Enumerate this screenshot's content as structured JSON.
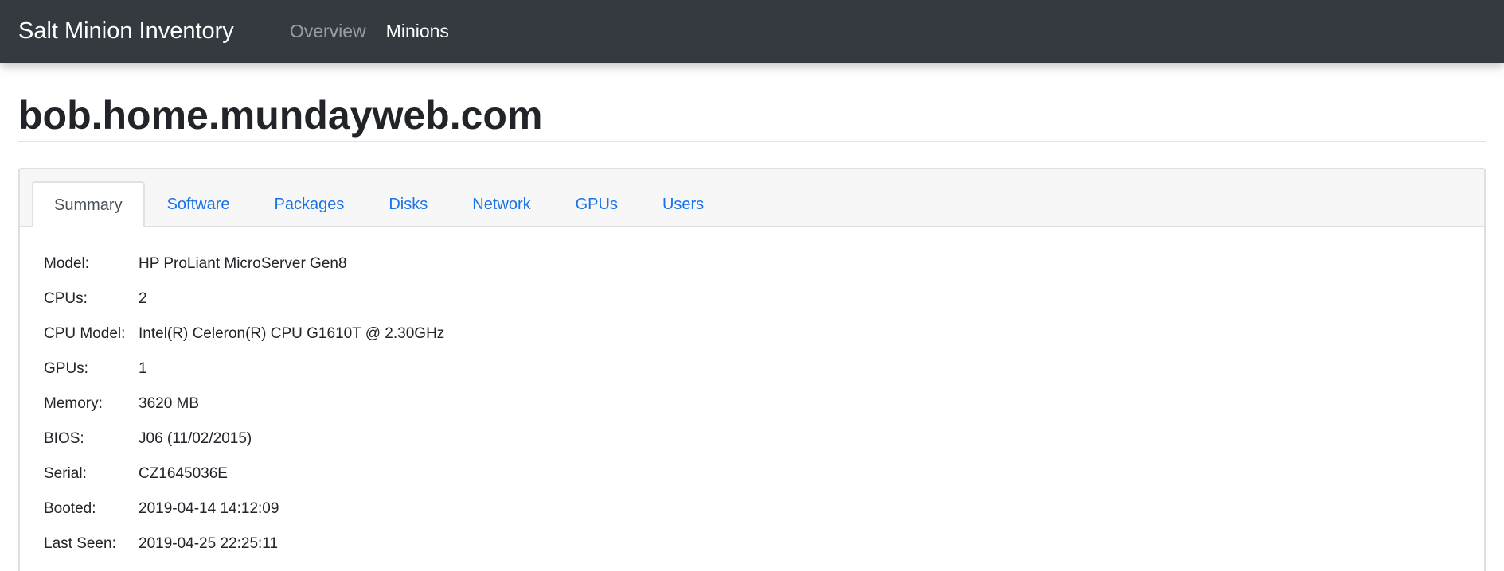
{
  "navbar": {
    "brand": "Salt Minion Inventory",
    "links": [
      {
        "label": "Overview",
        "active": false
      },
      {
        "label": "Minions",
        "active": true
      }
    ]
  },
  "page": {
    "title": "bob.home.mundayweb.com"
  },
  "tabs": [
    {
      "label": "Summary",
      "active": true
    },
    {
      "label": "Software",
      "active": false
    },
    {
      "label": "Packages",
      "active": false
    },
    {
      "label": "Disks",
      "active": false
    },
    {
      "label": "Network",
      "active": false
    },
    {
      "label": "GPUs",
      "active": false
    },
    {
      "label": "Users",
      "active": false
    }
  ],
  "summary": {
    "model": {
      "label": "Model:",
      "value": "HP ProLiant MicroServer Gen8"
    },
    "cpus": {
      "label": "CPUs:",
      "value": "2"
    },
    "cpu_model": {
      "label": "CPU Model:",
      "value": "Intel(R) Celeron(R) CPU G1610T @ 2.30GHz"
    },
    "gpus": {
      "label": "GPUs:",
      "value": "1"
    },
    "memory": {
      "label": "Memory:",
      "value": "3620 MB"
    },
    "bios": {
      "label": "BIOS:",
      "value": "J06 (11/02/2015)"
    },
    "serial": {
      "label": "Serial:",
      "value": "CZ1645036E"
    },
    "booted": {
      "label": "Booted:",
      "value": "2019-04-14 14:12:09"
    },
    "last_seen": {
      "label": "Last Seen:",
      "value": "2019-04-25 22:25:11"
    }
  },
  "colors": {
    "navbar_bg": "#343a40",
    "link_blue": "#1a73e8"
  }
}
